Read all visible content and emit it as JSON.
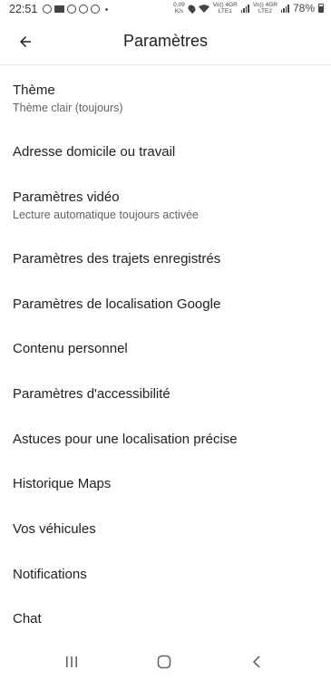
{
  "status_bar": {
    "time": "22:51",
    "net_speed_value": "0,09",
    "net_speed_unit": "K/s",
    "sim1_top": "Vo)) 4GR",
    "sim1_bottom": "LTE1",
    "sim2_top": "Vo)) 4GR",
    "sim2_bottom": "LTE2",
    "battery": "78%"
  },
  "header": {
    "title": "Paramètres",
    "back_icon": "arrow-back-icon"
  },
  "settings": {
    "items": [
      {
        "label": "Thème",
        "sublabel": "Thème clair (toujours)"
      },
      {
        "label": "Adresse domicile ou travail"
      },
      {
        "label": "Paramètres vidéo",
        "sublabel": "Lecture automatique toujours activée"
      },
      {
        "label": "Paramètres des trajets enregistrés"
      },
      {
        "label": "Paramètres de localisation Google"
      },
      {
        "label": "Contenu personnel"
      },
      {
        "label": "Paramètres d'accessibilité"
      },
      {
        "label": "Astuces pour une localisation précise"
      },
      {
        "label": "Historique Maps"
      },
      {
        "label": "Vos véhicules"
      },
      {
        "label": "Notifications"
      },
      {
        "label": "Chat"
      }
    ]
  },
  "nav_bar": {
    "recents_icon": "recents-icon",
    "home_icon": "home-icon",
    "back_icon": "back-chevron-icon"
  },
  "colors": {
    "text_primary": "#202124",
    "text_secondary": "#5f6368",
    "background": "#ffffff"
  }
}
